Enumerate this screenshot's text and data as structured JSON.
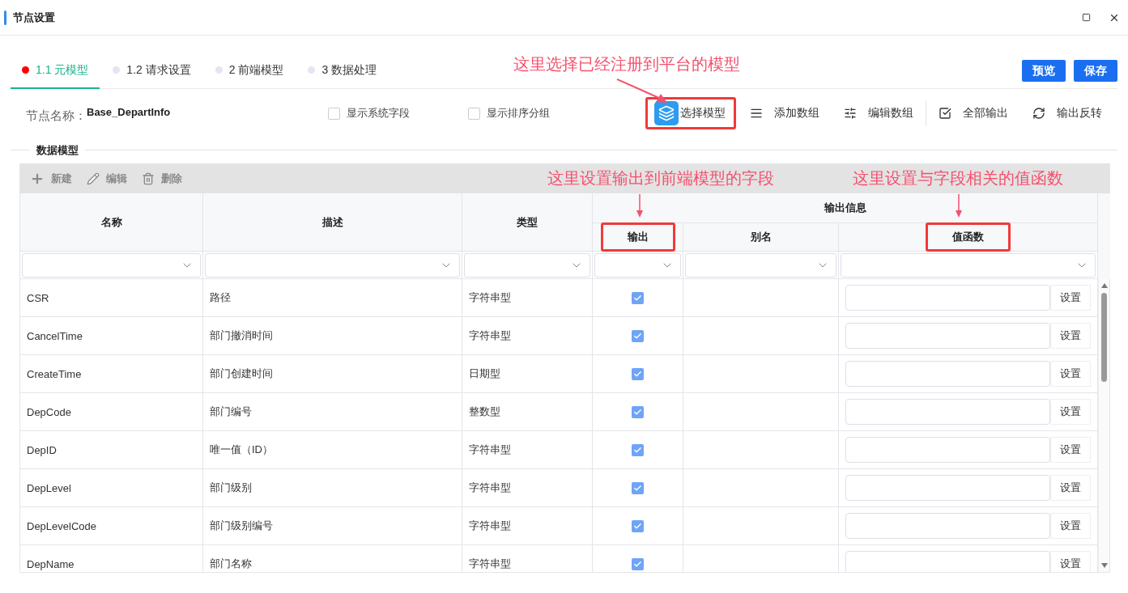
{
  "window": {
    "title": "节点设置"
  },
  "tabs": [
    {
      "label": "1.1 元模型",
      "selected": true
    },
    {
      "label": "1.2 请求设置",
      "selected": false
    },
    {
      "label": "2 前端模型",
      "selected": false
    },
    {
      "label": "3 数据处理",
      "selected": false
    }
  ],
  "header_buttons": [
    "预览",
    "保存"
  ],
  "node": {
    "label": "节点名称：",
    "value": "Base_DepartInfo"
  },
  "options": [
    {
      "label": "显示系统字段",
      "checked": false
    },
    {
      "label": "显示排序分组",
      "checked": false
    }
  ],
  "actions": [
    {
      "label": "选择模型",
      "kind": "layers",
      "highlighted": true
    },
    {
      "label": "添加数组",
      "kind": "list",
      "highlighted": false
    },
    {
      "label": "编辑数组",
      "kind": "sliders",
      "highlighted": false
    },
    {
      "label": "全部输出",
      "kind": "check",
      "highlighted": false
    },
    {
      "label": "输出反转",
      "kind": "refresh",
      "highlighted": false
    }
  ],
  "section_title": "数据模型",
  "grid_toolbar": [
    {
      "label": "新建",
      "kind": "add",
      "disabled": true
    },
    {
      "label": "编辑",
      "kind": "edit",
      "disabled": true
    },
    {
      "label": "删除",
      "kind": "delete",
      "disabled": true
    }
  ],
  "columns": {
    "name": "名称",
    "description": "描述",
    "type": "类型",
    "group": "输出信息",
    "output": {
      "label": "输出",
      "highlighted": true
    },
    "alias": {
      "label": "别名",
      "highlighted": false
    },
    "value_function": {
      "label": "值函数",
      "highlighted": true
    }
  },
  "rows": [
    {
      "name": "CSR",
      "description": "路径",
      "type": "字符串型",
      "output": true,
      "button": "设置"
    },
    {
      "name": "CancelTime",
      "description": "部门撤消时间",
      "type": "字符串型",
      "output": true,
      "button": "设置"
    },
    {
      "name": "CreateTime",
      "description": "部门创建时间",
      "type": "日期型",
      "output": true,
      "button": "设置"
    },
    {
      "name": "DepCode",
      "description": "部门编号",
      "type": "整数型",
      "output": true,
      "button": "设置"
    },
    {
      "name": "DepID",
      "description": "唯一值（ID）",
      "type": "字符串型",
      "output": true,
      "button": "设置"
    },
    {
      "name": "DepLevel",
      "description": "部门级别",
      "type": "字符串型",
      "output": true,
      "button": "设置"
    },
    {
      "name": "DepLevelCode",
      "description": "部门级别编号",
      "type": "字符串型",
      "output": true,
      "button": "设置"
    },
    {
      "name": "DepName",
      "description": "部门名称",
      "type": "字符串型",
      "output": true,
      "button": "设置"
    }
  ],
  "annotations": [
    {
      "text": "这里选择已经注册到平台的模型"
    },
    {
      "text": "这里设置输出到前端模型的字段"
    },
    {
      "text": "这里设置与字段相关的值函数"
    }
  ]
}
